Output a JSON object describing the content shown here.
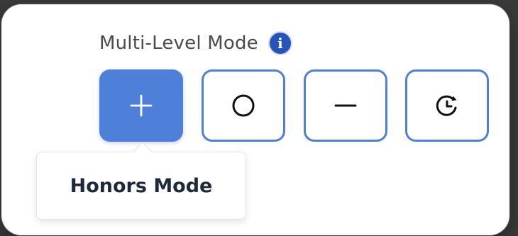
{
  "panel": {
    "title": "Multi-Level Mode",
    "info_icon": "i"
  },
  "buttons": [
    {
      "name": "add-mode",
      "icon": "plus-icon",
      "active": true
    },
    {
      "name": "circle-mode",
      "icon": "circle-icon",
      "active": false
    },
    {
      "name": "minus-mode",
      "icon": "minus-icon",
      "active": false
    },
    {
      "name": "history-mode",
      "icon": "history-icon",
      "active": false
    }
  ],
  "tooltip": {
    "label": "Honors Mode"
  },
  "colors": {
    "accent": "#4f80d9",
    "info_badge": "#2555b8",
    "title_text": "#4a4a4a",
    "tooltip_text": "#1e2a3b"
  }
}
